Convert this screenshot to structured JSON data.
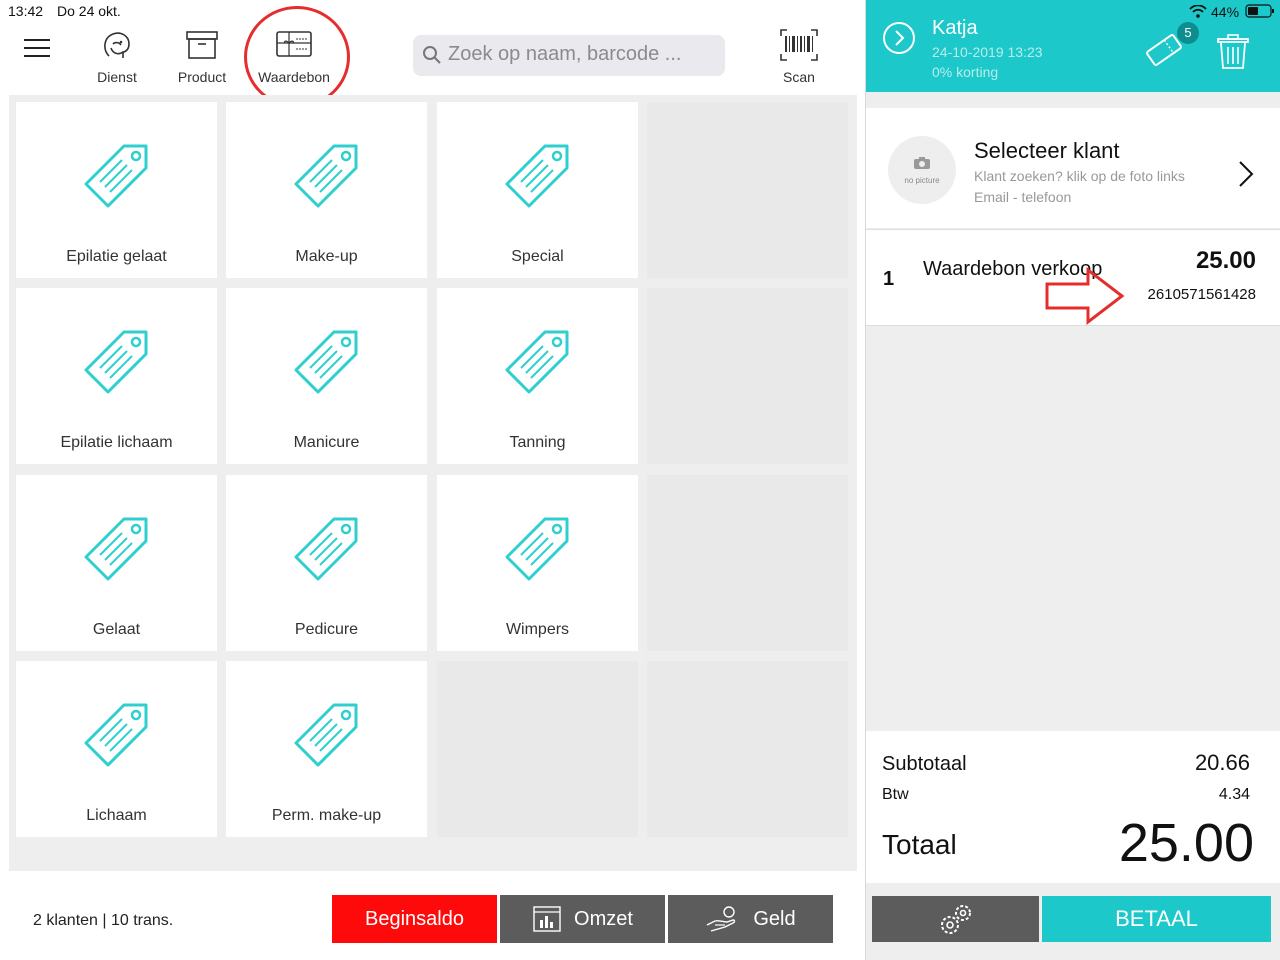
{
  "status": {
    "time": "13:42",
    "date": "Do 24 okt.",
    "battery": "44%"
  },
  "toolbar": {
    "menu_icon": "hamburger-icon",
    "items": [
      {
        "label": "Dienst",
        "icon": "face-icon"
      },
      {
        "label": "Product",
        "icon": "box-icon"
      },
      {
        "label": "Waardebon",
        "icon": "gift-card-icon"
      }
    ],
    "search_placeholder": "Zoek op naam, barcode ...",
    "scan_label": "Scan"
  },
  "tiles": [
    {
      "label": "Epilatie gelaat"
    },
    {
      "label": "Make-up"
    },
    {
      "label": "Special"
    },
    {
      "label": "Epilatie lichaam"
    },
    {
      "label": "Manicure"
    },
    {
      "label": "Tanning"
    },
    {
      "label": "Gelaat"
    },
    {
      "label": "Pedicure"
    },
    {
      "label": "Wimpers"
    },
    {
      "label": "Lichaam"
    },
    {
      "label": "Perm. make-up"
    }
  ],
  "footer": {
    "info": "2 klanten | 10 trans.",
    "begin_label": "Beginsaldo",
    "omzet_label": "Omzet",
    "geld_label": "Geld"
  },
  "cart": {
    "employee": "Katja",
    "datetime": "24-10-2019 13:23",
    "discount": "0% korting",
    "badge_count": "5",
    "customer": {
      "title": "Selecteer klant",
      "subtitle": "Klant zoeken? klik op de foto links",
      "subtitle2": "Email - telefoon",
      "avatar_text": "no picture"
    },
    "line": {
      "qty": "1",
      "name": "Waardebon verkoop",
      "price": "25.00",
      "code": "2610571561428"
    },
    "subtotal_label": "Subtotaal",
    "subtotal": "20.66",
    "vat_label": "Btw",
    "vat": "4.34",
    "total_label": "Totaal",
    "total": "25.00",
    "pay_label": "BETAAL"
  },
  "colors": {
    "accent": "#1cc8c9",
    "danger": "#ff0a0a",
    "dark_button": "#5c5c5c",
    "annotation": "#e52d2d"
  }
}
